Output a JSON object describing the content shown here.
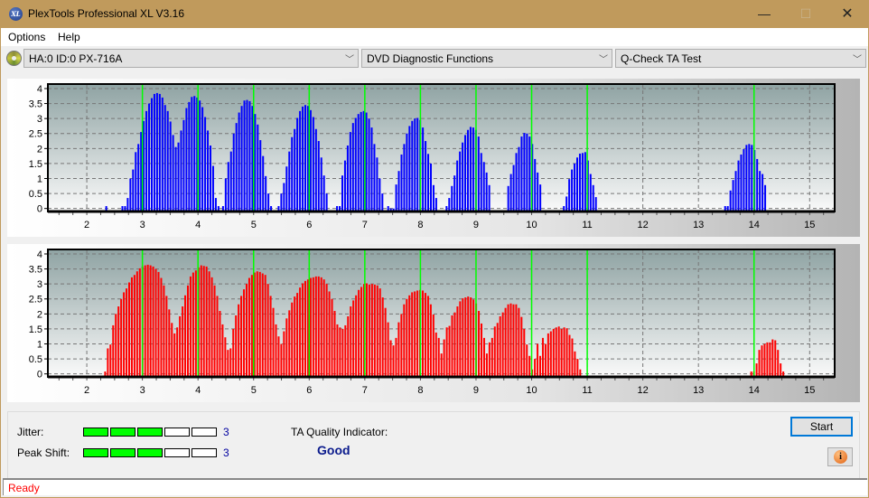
{
  "window": {
    "title": "PlexTools Professional XL V3.16",
    "icon": "xl-logo-icon",
    "controls": {
      "minimize": "—",
      "maximize": "☐",
      "close": "✕"
    }
  },
  "menu": {
    "items": [
      "Options",
      "Help"
    ]
  },
  "toolbar": {
    "drive_icon": "disc-icon",
    "drive": "HA:0 ID:0  PX-716A",
    "function_group": "DVD Diagnostic Functions",
    "test": "Q-Check TA Test",
    "arrow": "﹀"
  },
  "colors": {
    "title_bar": "#c09a5c",
    "jitter_bars": "#0000ff",
    "peak_bars": "#ff0000",
    "marker_lines": "#00ff00",
    "meter_on": "#00ff00",
    "status_text": "#ff0000",
    "quality_text": "#0a1a8c"
  },
  "chart_data": [
    {
      "type": "bar",
      "name": "TA distribution (land/top)",
      "color": "#0000ff",
      "xlim": [
        1.3,
        15.45
      ],
      "ylim": [
        -0.1,
        4.15
      ],
      "yticks": [
        0,
        0.5,
        1,
        1.5,
        2,
        2.5,
        3,
        3.5,
        4
      ],
      "ytick_labels": [
        "0",
        "0.5",
        "1",
        "1.5",
        "2",
        "2.5",
        "3",
        "3.5",
        "4"
      ],
      "xticks": [
        2,
        3,
        4,
        5,
        6,
        7,
        8,
        9,
        10,
        11,
        12,
        13,
        14,
        15
      ],
      "xtick_labels": [
        "2",
        "3",
        "4",
        "5",
        "6",
        "7",
        "8",
        "9",
        "10",
        "11",
        "12",
        "13",
        "14",
        "15"
      ],
      "markers": [
        3,
        4,
        5,
        6,
        7,
        8,
        9,
        10,
        11,
        14
      ],
      "grid": true,
      "bar_step": 0.048,
      "clusters": [
        {
          "x0": 2.35,
          "values": [
            0.08
          ]
        },
        {
          "x0": 2.64,
          "values": [
            0.08,
            0.08,
            0.35,
            1.0,
            1.3,
            1.88,
            2.15,
            2.55,
            2.92,
            3.25,
            3.5,
            3.68,
            3.82,
            3.85,
            3.82,
            3.7,
            3.45,
            3.25,
            2.9,
            2.45,
            2.05,
            2.2,
            2.6,
            2.95,
            3.35,
            3.55,
            3.72,
            3.75,
            3.7,
            3.6,
            3.38,
            3.05,
            2.6,
            2.1,
            1.42,
            0.35,
            0.08
          ]
        },
        {
          "x0": 4.45,
          "values": [
            0.08,
            1.0,
            1.55,
            1.9,
            2.5,
            2.85,
            3.2,
            3.42,
            3.6,
            3.62,
            3.58,
            3.42,
            3.15,
            2.8,
            2.28,
            1.75,
            1.08,
            0.5,
            0.08
          ]
        },
        {
          "x0": 5.45,
          "values": [
            0.08,
            0.5,
            0.85,
            1.4,
            1.9,
            2.38,
            2.65,
            3.02,
            3.25,
            3.4,
            3.45,
            3.42,
            3.28,
            3.05,
            2.65,
            2.25,
            1.7,
            1.1,
            0.5
          ]
        },
        {
          "x0": 6.5,
          "values": [
            0.08,
            0.08,
            1.1,
            1.6,
            2.1,
            2.55,
            2.85,
            3.02,
            3.15,
            3.22,
            3.25,
            3.2,
            3.0,
            2.7,
            2.15,
            1.7,
            1.0,
            0.5
          ]
        },
        {
          "x0": 7.42,
          "values": [
            0.08,
            0.0,
            0.0,
            0.8,
            1.25,
            1.8,
            2.15,
            2.5,
            2.75,
            2.92,
            3.0,
            3.02,
            2.95,
            2.7,
            2.25,
            1.82,
            1.5,
            0.78,
            0.35
          ]
        },
        {
          "x0": 8.47,
          "values": [
            0.08,
            0.35,
            0.75,
            1.1,
            1.6,
            1.9,
            2.2,
            2.45,
            2.62,
            2.72,
            2.7,
            2.62,
            2.4,
            1.85,
            1.55,
            1.2,
            0.78
          ]
        },
        {
          "x0": 9.58,
          "values": [
            0.75,
            1.15,
            1.45,
            1.85,
            2.05,
            2.4,
            2.52,
            2.5,
            2.4,
            2.15,
            1.65,
            1.2,
            0.8
          ]
        },
        {
          "x0": 10.58,
          "values": [
            0.08,
            0.4,
            0.98,
            1.3,
            1.5,
            1.7,
            1.83,
            1.85,
            1.88,
            1.6,
            1.15,
            0.78,
            0.38
          ]
        },
        {
          "x0": 13.48,
          "values": [
            0.08,
            0.08,
            0.6,
            0.95,
            1.25,
            1.6,
            1.8,
            1.98,
            2.12,
            2.15,
            2.12,
            1.95,
            1.65,
            1.25,
            1.15,
            0.78
          ]
        }
      ]
    },
    {
      "type": "bar",
      "name": "TA distribution (pit/groove)",
      "color": "#ff0000",
      "xlim": [
        1.3,
        15.45
      ],
      "ylim": [
        -0.1,
        4.15
      ],
      "yticks": [
        0,
        0.5,
        1,
        1.5,
        2,
        2.5,
        3,
        3.5,
        4
      ],
      "ytick_labels": [
        "0",
        "0.5",
        "1",
        "1.5",
        "2",
        "2.5",
        "3",
        "3.5",
        "4"
      ],
      "xticks": [
        2,
        3,
        4,
        5,
        6,
        7,
        8,
        9,
        10,
        11,
        12,
        13,
        14,
        15
      ],
      "xtick_labels": [
        "2",
        "3",
        "4",
        "5",
        "6",
        "7",
        "8",
        "9",
        "10",
        "11",
        "12",
        "13",
        "14",
        "15"
      ],
      "markers": [
        3,
        4,
        5,
        6,
        7,
        8,
        9,
        10,
        11,
        14
      ],
      "grid": true,
      "bar_step": 0.048,
      "clusters": [
        {
          "x0": 2.33,
          "values": [
            0.08,
            0.85,
            0.98,
            1.62,
            2.0,
            2.25,
            2.5,
            2.72,
            2.85,
            3.05,
            3.22,
            3.3,
            3.42,
            3.52,
            3.58,
            3.62,
            3.64,
            3.62,
            3.58,
            3.5,
            3.4,
            3.2,
            2.95,
            2.6,
            2.15,
            1.7,
            1.35,
            1.55,
            1.92,
            2.25,
            2.62,
            2.95,
            3.25,
            3.38,
            3.45,
            3.55,
            3.62,
            3.6,
            3.58,
            3.42,
            3.22,
            2.95,
            2.6,
            2.1,
            1.65,
            1.22,
            0.8,
            0.85,
            1.5,
            1.95,
            2.32,
            2.6,
            2.82,
            3.0,
            3.2,
            3.3,
            3.38,
            3.42,
            3.4,
            3.35,
            3.3,
            3.0,
            2.6,
            2.2,
            1.65,
            1.25,
            1.0,
            1.42,
            1.85,
            2.12,
            2.38,
            2.58,
            2.7,
            2.88,
            3.02,
            3.1,
            3.15,
            3.2,
            3.22,
            3.25,
            3.25,
            3.22,
            3.15,
            3.0,
            2.75,
            2.5,
            2.1,
            1.65,
            1.55,
            1.5,
            1.62,
            1.92,
            2.25,
            2.45,
            2.62,
            2.8,
            2.9,
            3.0,
            3.02,
            2.98,
            3.0,
            2.98,
            2.95,
            2.85,
            2.55,
            2.2,
            1.72,
            1.12,
            0.95,
            1.2,
            1.72,
            2.0,
            2.32,
            2.5,
            2.62,
            2.72,
            2.75,
            2.78,
            2.8,
            2.78,
            2.7,
            2.6,
            2.32,
            1.98,
            1.38,
            1.2,
            0.68,
            1.15,
            1.55,
            1.6,
            1.95,
            2.05,
            2.25,
            2.42,
            2.52,
            2.55,
            2.58,
            2.55,
            2.48,
            2.35,
            2.1,
            1.68,
            1.2,
            0.68,
            1.05,
            1.2,
            1.58,
            1.7,
            1.92,
            2.05,
            2.2,
            2.32,
            2.35,
            2.32,
            2.32,
            2.2,
            1.9,
            1.5,
            0.98,
            0.6,
            0.15,
            0.5,
            1.0,
            0.6,
            1.2,
            1.0,
            1.35,
            1.42,
            1.5,
            1.55,
            1.58,
            1.5,
            1.55,
            1.52,
            1.3,
            1.18,
            0.75,
            0.5,
            0.15
          ]
        },
        {
          "x0": 13.95,
          "values": [
            0.08,
            0.08,
            0.35,
            0.8,
            0.95,
            1.0,
            1.05,
            1.05,
            1.15,
            1.12,
            0.8,
            0.35,
            0.08
          ]
        }
      ]
    }
  ],
  "metrics": {
    "jitter": {
      "label": "Jitter:",
      "score": 3,
      "max": 5,
      "value_text": "3"
    },
    "peak_shift": {
      "label": "Peak Shift:",
      "score": 3,
      "max": 5,
      "value_text": "3"
    },
    "ta_quality_label": "TA Quality Indicator:",
    "ta_quality_value": "Good"
  },
  "buttons": {
    "start": "Start",
    "info_icon": "info-icon",
    "info_glyph": "i"
  },
  "status": {
    "text": "Ready"
  }
}
